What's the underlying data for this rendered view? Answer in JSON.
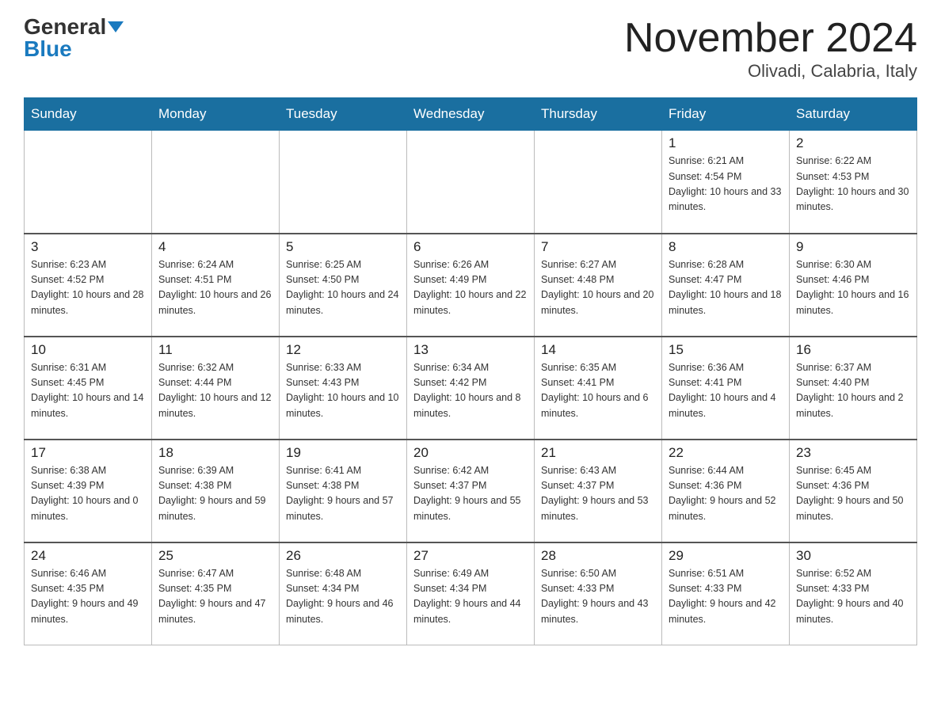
{
  "header": {
    "logo_general": "General",
    "logo_blue": "Blue",
    "month_title": "November 2024",
    "location": "Olivadi, Calabria, Italy"
  },
  "days_of_week": [
    "Sunday",
    "Monday",
    "Tuesday",
    "Wednesday",
    "Thursday",
    "Friday",
    "Saturday"
  ],
  "weeks": [
    [
      {
        "num": "",
        "info": ""
      },
      {
        "num": "",
        "info": ""
      },
      {
        "num": "",
        "info": ""
      },
      {
        "num": "",
        "info": ""
      },
      {
        "num": "",
        "info": ""
      },
      {
        "num": "1",
        "info": "Sunrise: 6:21 AM\nSunset: 4:54 PM\nDaylight: 10 hours and 33 minutes."
      },
      {
        "num": "2",
        "info": "Sunrise: 6:22 AM\nSunset: 4:53 PM\nDaylight: 10 hours and 30 minutes."
      }
    ],
    [
      {
        "num": "3",
        "info": "Sunrise: 6:23 AM\nSunset: 4:52 PM\nDaylight: 10 hours and 28 minutes."
      },
      {
        "num": "4",
        "info": "Sunrise: 6:24 AM\nSunset: 4:51 PM\nDaylight: 10 hours and 26 minutes."
      },
      {
        "num": "5",
        "info": "Sunrise: 6:25 AM\nSunset: 4:50 PM\nDaylight: 10 hours and 24 minutes."
      },
      {
        "num": "6",
        "info": "Sunrise: 6:26 AM\nSunset: 4:49 PM\nDaylight: 10 hours and 22 minutes."
      },
      {
        "num": "7",
        "info": "Sunrise: 6:27 AM\nSunset: 4:48 PM\nDaylight: 10 hours and 20 minutes."
      },
      {
        "num": "8",
        "info": "Sunrise: 6:28 AM\nSunset: 4:47 PM\nDaylight: 10 hours and 18 minutes."
      },
      {
        "num": "9",
        "info": "Sunrise: 6:30 AM\nSunset: 4:46 PM\nDaylight: 10 hours and 16 minutes."
      }
    ],
    [
      {
        "num": "10",
        "info": "Sunrise: 6:31 AM\nSunset: 4:45 PM\nDaylight: 10 hours and 14 minutes."
      },
      {
        "num": "11",
        "info": "Sunrise: 6:32 AM\nSunset: 4:44 PM\nDaylight: 10 hours and 12 minutes."
      },
      {
        "num": "12",
        "info": "Sunrise: 6:33 AM\nSunset: 4:43 PM\nDaylight: 10 hours and 10 minutes."
      },
      {
        "num": "13",
        "info": "Sunrise: 6:34 AM\nSunset: 4:42 PM\nDaylight: 10 hours and 8 minutes."
      },
      {
        "num": "14",
        "info": "Sunrise: 6:35 AM\nSunset: 4:41 PM\nDaylight: 10 hours and 6 minutes."
      },
      {
        "num": "15",
        "info": "Sunrise: 6:36 AM\nSunset: 4:41 PM\nDaylight: 10 hours and 4 minutes."
      },
      {
        "num": "16",
        "info": "Sunrise: 6:37 AM\nSunset: 4:40 PM\nDaylight: 10 hours and 2 minutes."
      }
    ],
    [
      {
        "num": "17",
        "info": "Sunrise: 6:38 AM\nSunset: 4:39 PM\nDaylight: 10 hours and 0 minutes."
      },
      {
        "num": "18",
        "info": "Sunrise: 6:39 AM\nSunset: 4:38 PM\nDaylight: 9 hours and 59 minutes."
      },
      {
        "num": "19",
        "info": "Sunrise: 6:41 AM\nSunset: 4:38 PM\nDaylight: 9 hours and 57 minutes."
      },
      {
        "num": "20",
        "info": "Sunrise: 6:42 AM\nSunset: 4:37 PM\nDaylight: 9 hours and 55 minutes."
      },
      {
        "num": "21",
        "info": "Sunrise: 6:43 AM\nSunset: 4:37 PM\nDaylight: 9 hours and 53 minutes."
      },
      {
        "num": "22",
        "info": "Sunrise: 6:44 AM\nSunset: 4:36 PM\nDaylight: 9 hours and 52 minutes."
      },
      {
        "num": "23",
        "info": "Sunrise: 6:45 AM\nSunset: 4:36 PM\nDaylight: 9 hours and 50 minutes."
      }
    ],
    [
      {
        "num": "24",
        "info": "Sunrise: 6:46 AM\nSunset: 4:35 PM\nDaylight: 9 hours and 49 minutes."
      },
      {
        "num": "25",
        "info": "Sunrise: 6:47 AM\nSunset: 4:35 PM\nDaylight: 9 hours and 47 minutes."
      },
      {
        "num": "26",
        "info": "Sunrise: 6:48 AM\nSunset: 4:34 PM\nDaylight: 9 hours and 46 minutes."
      },
      {
        "num": "27",
        "info": "Sunrise: 6:49 AM\nSunset: 4:34 PM\nDaylight: 9 hours and 44 minutes."
      },
      {
        "num": "28",
        "info": "Sunrise: 6:50 AM\nSunset: 4:33 PM\nDaylight: 9 hours and 43 minutes."
      },
      {
        "num": "29",
        "info": "Sunrise: 6:51 AM\nSunset: 4:33 PM\nDaylight: 9 hours and 42 minutes."
      },
      {
        "num": "30",
        "info": "Sunrise: 6:52 AM\nSunset: 4:33 PM\nDaylight: 9 hours and 40 minutes."
      }
    ]
  ]
}
